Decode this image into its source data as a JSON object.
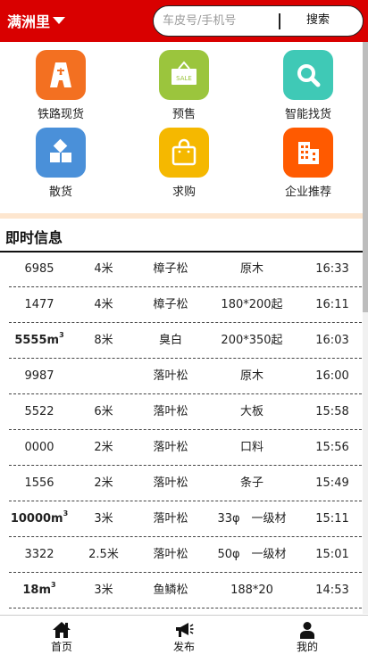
{
  "header": {
    "city": "满洲里",
    "search_placeholder": "车皮号/手机号",
    "search_button": "搜索"
  },
  "categories": [
    {
      "label": "铁路现货",
      "icon": "railway-icon",
      "color": "#f37021"
    },
    {
      "label": "预售",
      "icon": "sale-sign-icon",
      "color": "#9bc53d"
    },
    {
      "label": "智能找货",
      "icon": "magnifier-icon",
      "color": "#3fc9b6"
    },
    {
      "label": "散货",
      "icon": "blocks-icon",
      "color": "#4a90d9"
    },
    {
      "label": "求购",
      "icon": "shopping-bag-icon",
      "color": "#f5b800"
    },
    {
      "label": "企业推荐",
      "icon": "building-icon",
      "color": "#ff5a00"
    }
  ],
  "section": {
    "title": "即时信息"
  },
  "rows": [
    {
      "qty": "6985",
      "unit": "",
      "length": "4米",
      "wood": "樟子松",
      "spec": "原木",
      "time": "16:33",
      "bold": false
    },
    {
      "qty": "1477",
      "unit": "",
      "length": "4米",
      "wood": "樟子松",
      "spec": "180*200起",
      "time": "16:11",
      "bold": false
    },
    {
      "qty": "5555m",
      "unit": "3",
      "length": "8米",
      "wood": "臭白",
      "spec": "200*350起",
      "time": "16:03",
      "bold": true
    },
    {
      "qty": "9987",
      "unit": "",
      "length": "",
      "wood": "落叶松",
      "spec": "原木",
      "time": "16:00",
      "bold": false
    },
    {
      "qty": "5522",
      "unit": "",
      "length": "6米",
      "wood": "落叶松",
      "spec": "大板",
      "time": "15:58",
      "bold": false
    },
    {
      "qty": "0000",
      "unit": "",
      "length": "2米",
      "wood": "落叶松",
      "spec": "口料",
      "time": "15:56",
      "bold": false
    },
    {
      "qty": "1556",
      "unit": "",
      "length": "2米",
      "wood": "落叶松",
      "spec": "条子",
      "time": "15:49",
      "bold": false
    },
    {
      "qty": "10000m",
      "unit": "3",
      "length": "3米",
      "wood": "落叶松",
      "spec": "33φ　一级材",
      "time": "15:11",
      "bold": true
    },
    {
      "qty": "3322",
      "unit": "",
      "length": "2.5米",
      "wood": "落叶松",
      "spec": "50φ　一级材",
      "time": "15:01",
      "bold": false
    },
    {
      "qty": "18m",
      "unit": "3",
      "length": "3米",
      "wood": "鱼鳞松",
      "spec": "188*20",
      "time": "14:53",
      "bold": true
    }
  ],
  "tabbar": [
    {
      "label": "首页",
      "icon": "home-icon"
    },
    {
      "label": "发布",
      "icon": "megaphone-icon"
    },
    {
      "label": "我的",
      "icon": "user-icon"
    }
  ]
}
